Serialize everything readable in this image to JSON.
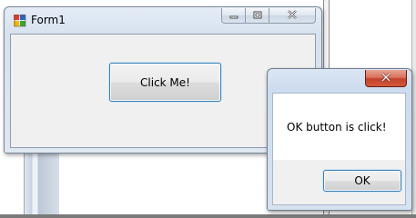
{
  "form1": {
    "title": "Form1",
    "icons": {
      "app": "winforms-app-icon",
      "minimize": "minimize-icon",
      "maximize": "maximize-icon",
      "close": "close-icon"
    },
    "button_label": "Click Me!"
  },
  "message_box": {
    "text": "OK button is click!",
    "ok_label": "OK",
    "icons": {
      "close": "close-icon"
    },
    "close_button_color": "#c2412a"
  },
  "colors": {
    "focus_border": "#3c7fb1",
    "client_background": "#f0f0f0"
  }
}
